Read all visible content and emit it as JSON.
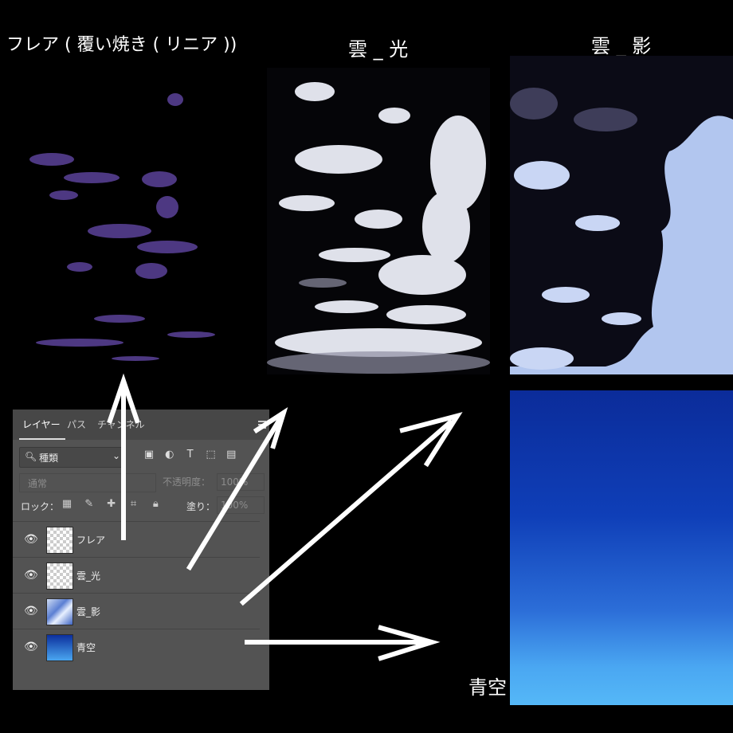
{
  "captions": {
    "flare": "フレア ( 覆い焼き ( リニア ))",
    "cloud_light": "雲 _ 光",
    "cloud_shadow": "雲 _ 影",
    "blue_sky": "青空"
  },
  "panel": {
    "tabs": [
      "レイヤー",
      "パス",
      "チャンネル"
    ],
    "search_label": "種類",
    "blend_mode": "通常",
    "opacity_label": "不透明度：",
    "opacity_value": "100%",
    "lock_label": "ロック：",
    "fill_label": "塗り：",
    "fill_value": "100%",
    "layers": [
      {
        "name": "フレア",
        "thumb": "transparent"
      },
      {
        "name": "雲_光",
        "thumb": "transparent"
      },
      {
        "name": "雲_影",
        "thumb": "clouds"
      },
      {
        "name": "青空",
        "thumb": "sky"
      }
    ]
  },
  "colors": {
    "background": "#000000",
    "panel": "#535353",
    "sky_top": "#0b2c9a",
    "sky_bottom": "#55b8f7",
    "flare": "#6a4fb0"
  }
}
